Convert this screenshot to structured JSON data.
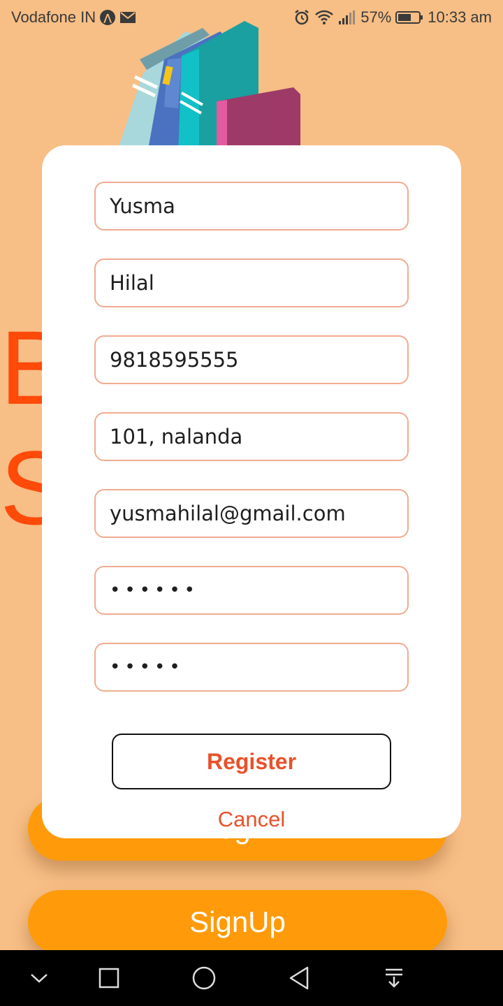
{
  "status_bar": {
    "carrier": "Vodafone IN",
    "carrier_badge": "⋀",
    "battery": "57%",
    "time": "10:33 am",
    "icons": [
      "carrier-badge-icon",
      "mail-icon",
      "alarm-icon",
      "wifi-icon",
      "signal-icon",
      "battery-icon"
    ]
  },
  "background": {
    "title_lines": [
      "B",
      "S"
    ],
    "login_label": "Login",
    "signup_label": "SignUp",
    "illustration": "books-icon"
  },
  "dialog": {
    "fields": {
      "first_name": "Yusma",
      "last_name": "Hilal",
      "phone": "9818595555",
      "address": "101, nalanda",
      "email": "yusmahilal@gmail.com",
      "password": "••••••",
      "confirm_password": "•••••"
    },
    "register_label": "Register",
    "cancel_label": "Cancel"
  },
  "nav_bar": {
    "icons": [
      "chevron-down-icon",
      "square-icon",
      "circle-icon",
      "back-triangle-icon",
      "notification-pull-icon"
    ]
  },
  "colors": {
    "background": "#f7be85",
    "accent_text": "#e8522a",
    "title_red": "#ff4a0a",
    "button_orange": "#ff9a0a",
    "field_border": "#f0ab90"
  }
}
